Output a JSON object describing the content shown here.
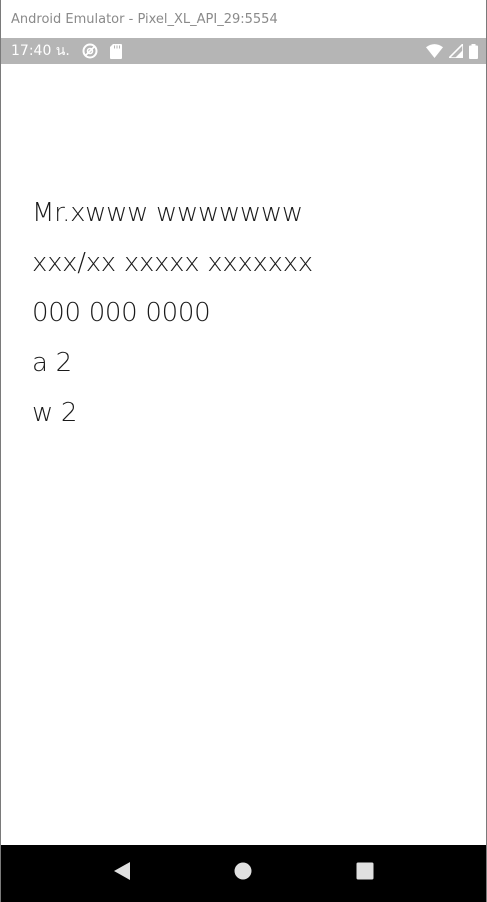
{
  "window": {
    "title": "Android Emulator - Pixel_XL_API_29:5554"
  },
  "status_bar": {
    "time": "17:40 น.",
    "icons_left": [
      "do-not-disturb-icon",
      "sd-card-icon"
    ],
    "icons_right": [
      "wifi-icon",
      "cell-signal-icon",
      "battery-icon"
    ]
  },
  "content": {
    "lines": [
      "Mr.xwww wwwwwww",
      "xxx/xx xxxxx xxxxxxx",
      "000 000 0000",
      "a 2",
      "w 2"
    ]
  },
  "nav_bar": {
    "buttons": [
      "back-icon",
      "home-icon",
      "recents-icon"
    ]
  },
  "colors": {
    "status_bar_bg": "#b5b5b5",
    "nav_bar_bg": "#000000",
    "text": "#1a1a1a"
  }
}
